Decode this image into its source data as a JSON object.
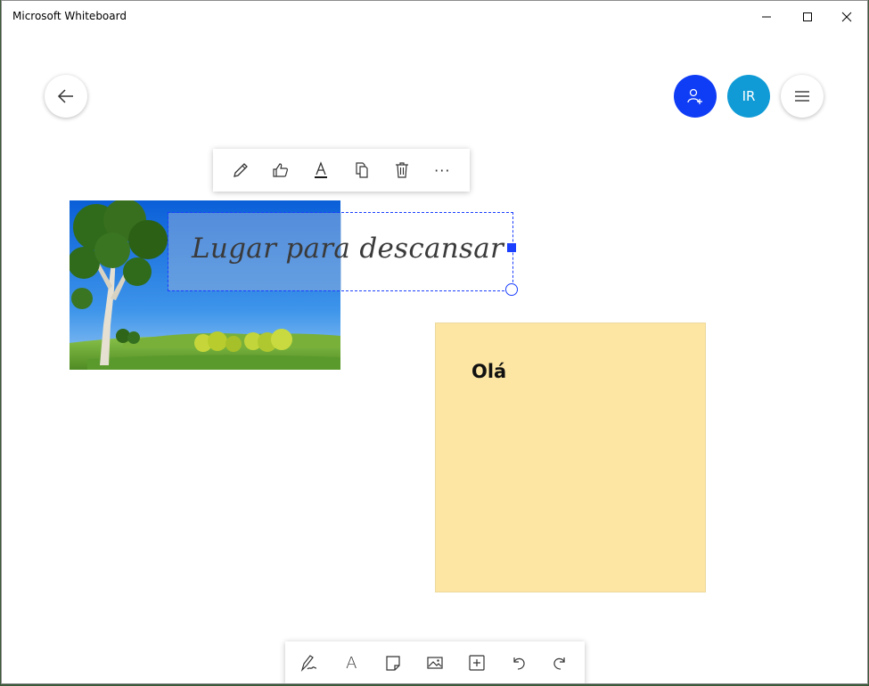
{
  "window": {
    "title": "Microsoft Whiteboard"
  },
  "header": {
    "back_icon": "arrow-left-icon",
    "invite_icon": "add-person-icon",
    "avatar_initials": "IR",
    "menu_icon": "hamburger-icon"
  },
  "context_toolbar": {
    "icons": [
      "pencil-icon",
      "thumbs-up-icon",
      "text-format-icon",
      "copy-icon",
      "trash-icon",
      "more-icon"
    ],
    "more_label": "···"
  },
  "board": {
    "text_item": "Lugar para descansar",
    "sticky_note": "Olá"
  },
  "bottom_toolbar": {
    "icons": [
      "ink-pen-icon",
      "text-icon",
      "note-icon",
      "image-icon",
      "insert-icon",
      "undo-icon",
      "redo-icon"
    ],
    "text_glyph": "A"
  },
  "colors": {
    "accent_blue": "#0f3cf5",
    "avatar_teal": "#109bd6",
    "sticky_yellow": "#fde6a3",
    "selection_blue": "#1b3fff"
  }
}
